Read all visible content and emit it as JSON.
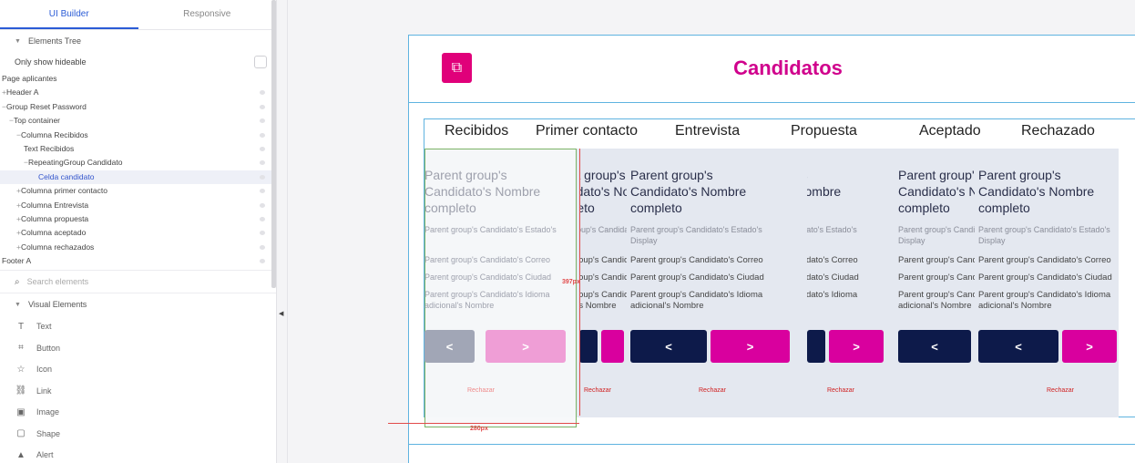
{
  "tabs": [
    {
      "label": "UI Builder"
    },
    {
      "label": "Responsive"
    }
  ],
  "elements_tree": {
    "heading": "Elements Tree",
    "only_hideable": "Only show hideable",
    "rows": [
      {
        "label": "Page aplicantes",
        "indent": 0,
        "prefix": ""
      },
      {
        "label": "Header A",
        "indent": 0,
        "prefix": "+"
      },
      {
        "label": "Group Reset Password",
        "indent": 0,
        "prefix": "−"
      },
      {
        "label": "Top container",
        "indent": 1,
        "prefix": "−"
      },
      {
        "label": "Columna Recibidos",
        "indent": 2,
        "prefix": "−"
      },
      {
        "label": "Text Recibidos",
        "indent": 3,
        "prefix": ""
      },
      {
        "label": "RepeatingGroup Candidato",
        "indent": 3,
        "prefix": "−"
      },
      {
        "label": "Celda candidato",
        "indent": 4,
        "prefix": "",
        "selected": true
      },
      {
        "label": "Columna primer contacto",
        "indent": 2,
        "prefix": "+"
      },
      {
        "label": "Columna Entrevista",
        "indent": 2,
        "prefix": "+"
      },
      {
        "label": "Columna propuesta",
        "indent": 2,
        "prefix": "+"
      },
      {
        "label": "Columna aceptado",
        "indent": 2,
        "prefix": "+"
      },
      {
        "label": "Columna rechazados",
        "indent": 2,
        "prefix": "+"
      },
      {
        "label": "Footer A",
        "indent": 0,
        "prefix": ""
      }
    ]
  },
  "search": {
    "placeholder": "Search elements"
  },
  "visual_elements": {
    "heading": "Visual Elements",
    "items": [
      {
        "label": "Text",
        "icon": "text-icon"
      },
      {
        "label": "Button",
        "icon": "button-icon"
      },
      {
        "label": "Icon",
        "icon": "star-icon"
      },
      {
        "label": "Link",
        "icon": "link-icon"
      },
      {
        "label": "Image",
        "icon": "image-icon"
      },
      {
        "label": "Shape",
        "icon": "shape-icon"
      },
      {
        "label": "Alert",
        "icon": "alert-icon"
      }
    ]
  },
  "canvas": {
    "title": "Candidatos",
    "columns": [
      "Recibidos",
      "Primer contacto",
      "Entrevista",
      "Propuesta",
      "Aceptado",
      "Rechazado"
    ],
    "card": {
      "name": "Parent group's Candidato's Nombre completo",
      "name_l1": "Parent group's",
      "name_l2": "Candidato's Nombre",
      "name_l3": "completo",
      "estado_l1": "Parent group's Candidato's Estado's",
      "estado_l2": "Display",
      "correo": "Parent group's Candidato's Correo",
      "ciudad": "Parent group's Candidato's Ciudad",
      "idioma_l1": "Parent group's Candidato's Idioma",
      "idioma_l2": "adicional's Nombre",
      "prev": "<",
      "next": ">",
      "reject": "Rechazar"
    },
    "dims": {
      "height_label": "397px",
      "width_label": "280px"
    },
    "colors": {
      "accent": "#d9009e",
      "navy": "#0d1a4a",
      "title": "#d0008c",
      "outline": "#5fb3e0"
    }
  }
}
